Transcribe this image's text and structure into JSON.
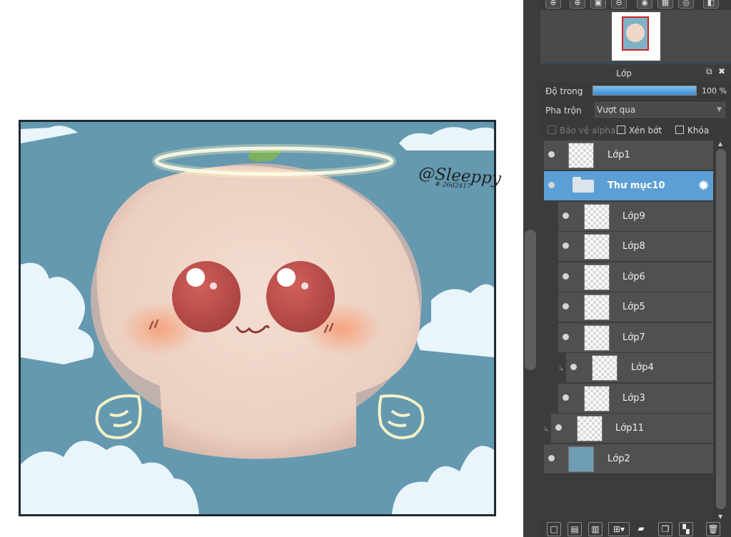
{
  "artwork": {
    "signature_text": "@Sleeppy",
    "signature_sub": "# 26d2417"
  },
  "navigator": {
    "toolbar": [
      "zoom-fit-icon",
      "zoom-in-icon",
      "actual-size-icon",
      "zoom-out-icon",
      "rotate-icon",
      "fit-icon",
      "rotate-reset-icon",
      "flip-icon"
    ]
  },
  "layer_panel": {
    "title": "Lớp",
    "opacity_label": "Độ trong",
    "opacity_percent": 100,
    "opacity_value": "100 %",
    "blend_label": "Pha trộn",
    "blend_value": "Vượt qua",
    "checkboxes": {
      "protect_alpha": "Bảo vệ alpha",
      "clipping": "Xén bớt",
      "lock": "Khóa"
    },
    "layers": [
      {
        "name": "Lớp1"
      },
      {
        "name": "Thư mục10"
      },
      {
        "name": "Lớp9"
      },
      {
        "name": "Lớp8"
      },
      {
        "name": "Lớp6"
      },
      {
        "name": "Lớp5"
      },
      {
        "name": "Lớp7"
      },
      {
        "name": "Lớp4"
      },
      {
        "name": "Lớp3"
      },
      {
        "name": "Lớp11"
      },
      {
        "name": "Lớp2"
      }
    ]
  },
  "colors": {
    "accent": "#5b9fd4",
    "panel_bg": "#3a3a3a",
    "layer_bg": "#505050",
    "canvas_sky": "#6499b0"
  }
}
